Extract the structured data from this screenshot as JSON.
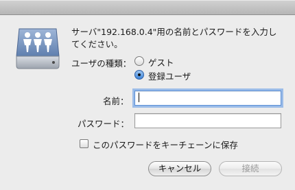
{
  "dialog": {
    "icon": "network-server-icon",
    "message": "サーバ\"192.168.0.4\"用の名前とパスワードを入力してください。",
    "user_type_label": "ユーザの種類：",
    "user_types": [
      {
        "label": "ゲスト",
        "selected": false
      },
      {
        "label": "登録ユーザ",
        "selected": true
      }
    ],
    "name_label": "名前：",
    "name_value": "",
    "password_label": "パスワード：",
    "password_value": "",
    "save_password_label": "このパスワードをキーチェーンに保存",
    "save_password_checked": false,
    "cancel_label": "キャンセル",
    "connect_label": "接続"
  },
  "colors": {
    "focus_ring": "#5a96e6",
    "icon_blue": "#6f8fbd",
    "radio_selected": "#3b83d8"
  }
}
